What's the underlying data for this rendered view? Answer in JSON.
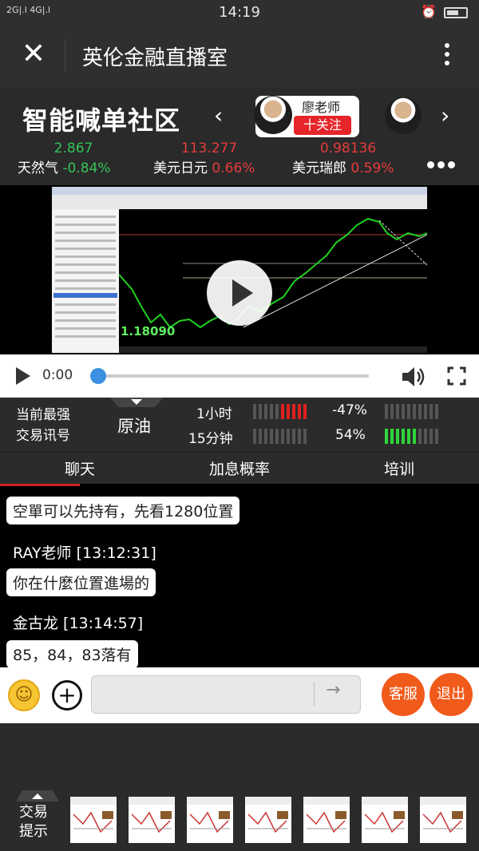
{
  "status_bar": {
    "signal": "2G|.l 4G|.l",
    "time": "14:19"
  },
  "title_bar": {
    "title": "英伦金融直播室"
  },
  "community": {
    "brand": "智能喊单社区",
    "teacher_name": "廖老师",
    "follow_label": "十关注"
  },
  "quotes": [
    {
      "value": "2.867",
      "name": "天然气",
      "change": "-0.84%",
      "dir": "up"
    },
    {
      "value": "113.277",
      "name": "美元日元",
      "change": "0.66%",
      "dir": "down"
    },
    {
      "value": "0.98136",
      "name": "美元瑞郎",
      "change": "0.59%",
      "dir": "down"
    }
  ],
  "video": {
    "price_label": "1.18090",
    "time": "0:00"
  },
  "signals": {
    "title_line1": "当前最强",
    "title_line2": "交易讯号",
    "product": "原油",
    "rows": [
      {
        "period": "1小时",
        "percent": "-47%",
        "left_active": 5,
        "left_color": "#e02020",
        "right_active": 0,
        "right_color": "#2ed63a"
      },
      {
        "period": "15分钟",
        "percent": "54%",
        "left_active": 0,
        "left_color": "#e02020",
        "right_active": 6,
        "right_color": "#2ed63a"
      }
    ]
  },
  "tabs": [
    "聊天",
    "加息概率",
    "培训"
  ],
  "chat": [
    {
      "type": "bubble",
      "text": "空單可以先持有，先看1280位置"
    },
    {
      "type": "author",
      "text": "RAY老师   [13:12:31]"
    },
    {
      "type": "bubble",
      "text": "你在什麼位置進場的"
    },
    {
      "type": "author",
      "text": "金古龙   [13:14:57]"
    },
    {
      "type": "bubble",
      "text": "85，84，83落有"
    }
  ],
  "input": {
    "send_glyph": "→",
    "service_label": "客服",
    "exit_label": "退出"
  },
  "tips": {
    "line1": "交易",
    "line2": "提示"
  },
  "thumbnails": 7
}
